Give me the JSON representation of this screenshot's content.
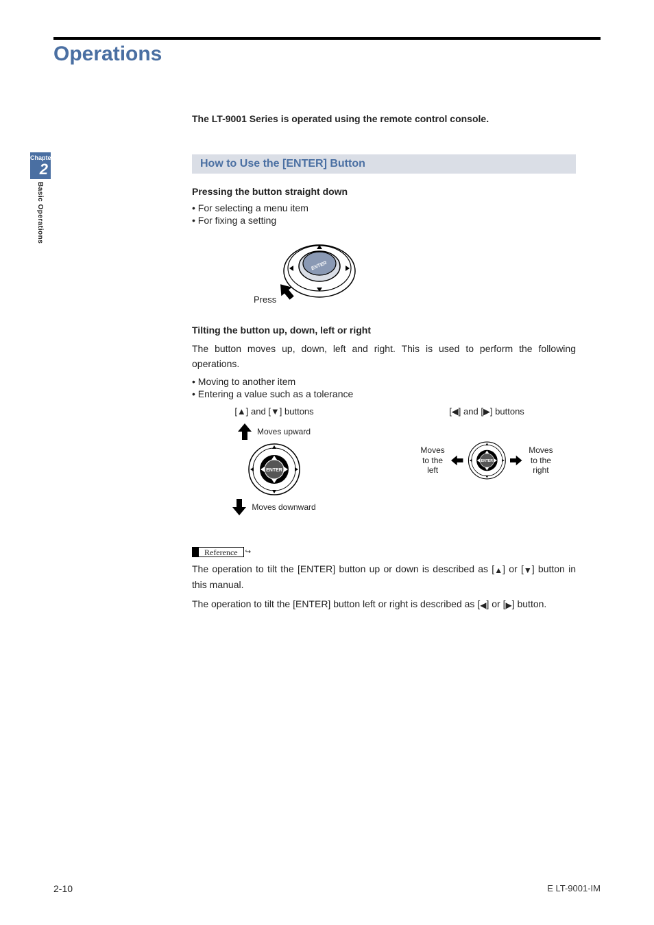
{
  "chapter_title": "Operations",
  "side": {
    "chapter_label": "Chapter",
    "chapter_num": "2",
    "caption": "Basic Operations"
  },
  "intro": "The LT-9001 Series is operated using the remote control console.",
  "section_heading": "How to Use the [ENTER] Button",
  "press": {
    "heading": "Pressing the button straight down",
    "bullet1": "• For selecting a menu item",
    "bullet2": "• For fixing a setting",
    "fig_label": "Press"
  },
  "tilt": {
    "heading": "Tilting the button up, down, left or right",
    "para": "The button moves up, down, left and right. This is used to perform the following operations.",
    "bullet1": "• Moving to another item",
    "bullet2": "• Entering a value such as a tolerance",
    "col_ud_label": "[▲] and [▼] buttons",
    "col_lr_label": "[◀] and [▶] buttons",
    "moves_up": "Moves upward",
    "moves_down": "Moves downward",
    "moves_left": "Moves to the left",
    "moves_right": "Moves to the right",
    "enter": "ENTER"
  },
  "reference": {
    "label": "Reference",
    "line1a": "The operation to tilt the [ENTER] button up or down is described as [",
    "line1b": "] or [",
    "line1c": "] button in this manual.",
    "line2a": "The operation to tilt the [ENTER] button left or right is described as [",
    "line2b": "] or [",
    "line2c": "] button."
  },
  "footer": {
    "page": "2-10",
    "doc": "E LT-9001-IM"
  },
  "glyphs": {
    "up": "▲",
    "down": "▼",
    "left": "◀",
    "right": "▶"
  }
}
